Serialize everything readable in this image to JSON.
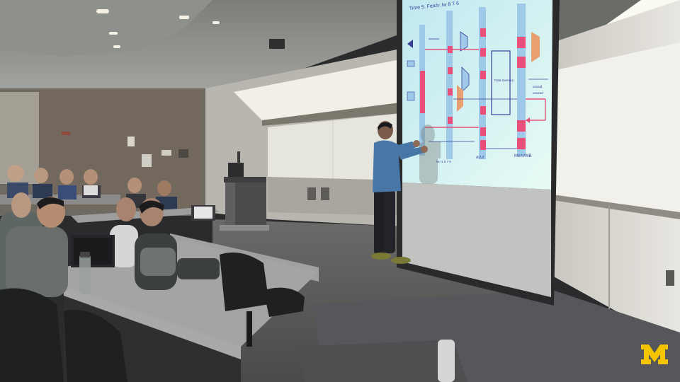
{
  "scene": {
    "setting": "lecture-hall",
    "colors": {
      "ceiling": "#8a8c88",
      "wall": "#7d7a72",
      "floor": "#5a5a58",
      "desk": "#9a9a98",
      "screen": "#d8f4f0",
      "slide_accent": "#e8507a",
      "slide_blue": "#9ec9e8",
      "logo_maize": "#f5c400"
    }
  },
  "slide": {
    "title": "Time 5: Fetch: lw 8 7 6",
    "box_label": "Data memory",
    "stage_label": "Mem/WB",
    "bottom_label_left": "ALU/",
    "bottom_label_mid": "lw r1 8 7 6",
    "side_label_top": "unsaid",
    "side_label_bottom": "unused"
  },
  "logo": {
    "text": "M",
    "icon": "university-block-m-icon"
  }
}
